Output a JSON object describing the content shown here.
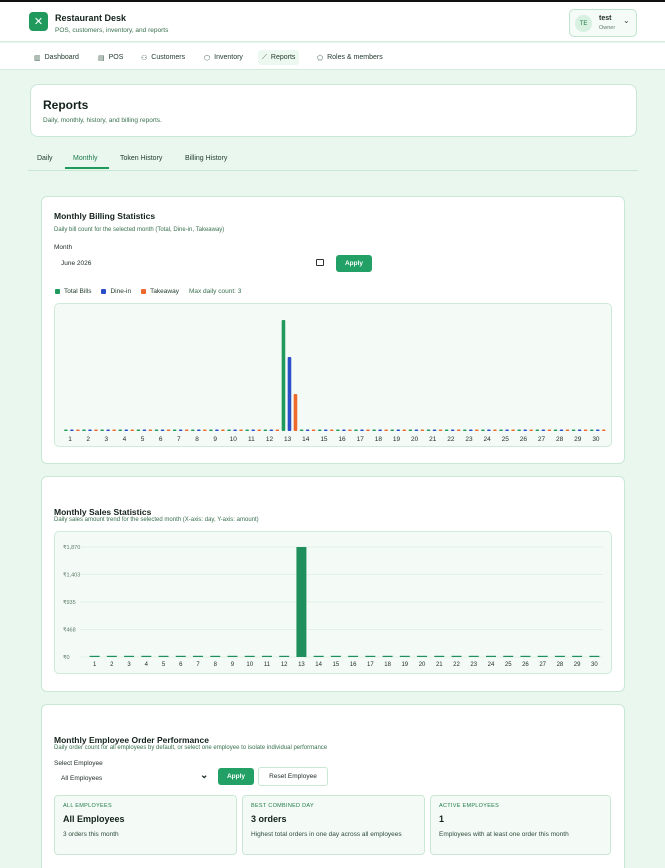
{
  "app": {
    "title": "Restaurant Desk",
    "subtitle": "POS, customers, inventory, and reports",
    "logo_icon": "utensils-icon"
  },
  "user": {
    "initials": "TE",
    "name": "test",
    "role": "Owner"
  },
  "nav": [
    {
      "label": "Dashboard",
      "icon": "chart-icon"
    },
    {
      "label": "POS",
      "icon": "pos-icon"
    },
    {
      "label": "Customers",
      "icon": "users-icon"
    },
    {
      "label": "Inventory",
      "icon": "box-icon"
    },
    {
      "label": "Reports",
      "icon": "report-icon",
      "active": true
    },
    {
      "label": "Roles & members",
      "icon": "shield-icon"
    }
  ],
  "page": {
    "title": "Reports",
    "subtitle": "Daily, monthly, history, and billing reports."
  },
  "tabs": [
    {
      "label": "Daily"
    },
    {
      "label": "Monthly",
      "active": true
    },
    {
      "label": "Token History"
    },
    {
      "label": "Billing History"
    }
  ],
  "billing": {
    "title": "Monthly Billing Statistics",
    "subtitle": "Daily bill count for the selected month (Total, Dine-in, Takeaway)",
    "month_label": "Month",
    "month_value": "June 2026",
    "apply_label": "Apply",
    "legend": [
      "Total Bills",
      "Dine-in",
      "Takeaway"
    ],
    "max_text": "Max daily count: 3"
  },
  "sales": {
    "title": "Monthly Sales Statistics",
    "subtitle": "Daily sales amount trend for the selected month (X-axis: day, Y-axis: amount)"
  },
  "employee": {
    "title": "Monthly Employee Order Performance",
    "subtitle": "Daily order count for all employees by default, or select one employee to isolate individual performance",
    "select_label": "Select Employee",
    "select_value": "All Employees",
    "apply_label": "Apply",
    "reset_label": "Reset Employee",
    "stats": [
      {
        "heading": "ALL EMPLOYEES",
        "value": "All Employees",
        "desc": "3 orders this month"
      },
      {
        "heading": "BEST COMBINED DAY",
        "value": "3 orders",
        "desc": "Highest total orders in one day across all employees"
      },
      {
        "heading": "ACTIVE EMPLOYEES",
        "value": "1",
        "desc": "Employees with at least one order this month"
      }
    ]
  },
  "colors": {
    "accent": "#22a065",
    "total": "#1f9a5c",
    "dinein": "#2b4fc7",
    "takeaway": "#ee6a2c",
    "sales_bar": "#1f8f5e"
  },
  "chart_data": [
    {
      "type": "bar",
      "title": "Monthly Billing Statistics",
      "categories": [
        "1",
        "2",
        "3",
        "4",
        "5",
        "6",
        "7",
        "8",
        "9",
        "10",
        "11",
        "12",
        "13",
        "14",
        "15",
        "16",
        "17",
        "18",
        "19",
        "20",
        "21",
        "22",
        "23",
        "24",
        "25",
        "26",
        "27",
        "28",
        "29",
        "30"
      ],
      "series": [
        {
          "name": "Total Bills",
          "values": [
            0,
            0,
            0,
            0,
            0,
            0,
            0,
            0,
            0,
            0,
            0,
            0,
            3,
            0,
            0,
            0,
            0,
            0,
            0,
            0,
            0,
            0,
            0,
            0,
            0,
            0,
            0,
            0,
            0,
            0
          ]
        },
        {
          "name": "Dine-in",
          "values": [
            0,
            0,
            0,
            0,
            0,
            0,
            0,
            0,
            0,
            0,
            0,
            0,
            2,
            0,
            0,
            0,
            0,
            0,
            0,
            0,
            0,
            0,
            0,
            0,
            0,
            0,
            0,
            0,
            0,
            0
          ]
        },
        {
          "name": "Takeaway",
          "values": [
            0,
            0,
            0,
            0,
            0,
            0,
            0,
            0,
            0,
            0,
            0,
            0,
            1,
            0,
            0,
            0,
            0,
            0,
            0,
            0,
            0,
            0,
            0,
            0,
            0,
            0,
            0,
            0,
            0,
            0
          ]
        }
      ],
      "ylim": [
        0,
        3
      ],
      "grid": false,
      "legend": "top-left"
    },
    {
      "type": "bar",
      "title": "Monthly Sales Statistics",
      "categories": [
        "1",
        "2",
        "3",
        "4",
        "5",
        "6",
        "7",
        "8",
        "9",
        "10",
        "11",
        "12",
        "13",
        "14",
        "15",
        "16",
        "17",
        "18",
        "19",
        "20",
        "21",
        "22",
        "23",
        "24",
        "25",
        "26",
        "27",
        "28",
        "29",
        "30"
      ],
      "values": [
        0,
        0,
        0,
        0,
        0,
        0,
        0,
        0,
        0,
        0,
        0,
        0,
        1870,
        0,
        0,
        0,
        0,
        0,
        0,
        0,
        0,
        0,
        0,
        0,
        0,
        0,
        0,
        0,
        0,
        0
      ],
      "yticks": [
        "₹0",
        "₹468",
        "₹935",
        "₹1,403",
        "₹1,870"
      ],
      "ylim": [
        0,
        1870
      ],
      "grid": true
    }
  ]
}
